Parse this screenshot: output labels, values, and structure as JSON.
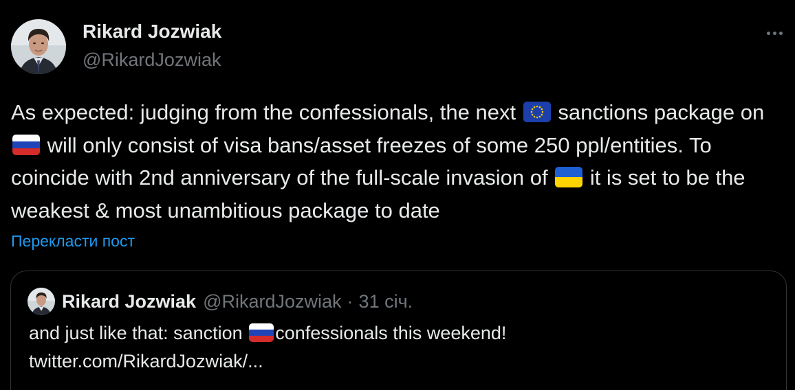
{
  "author": {
    "name": "Rikard Jozwiak",
    "handle": "@RikardJozwiak"
  },
  "tweet": {
    "part1": "As expected: judging from the confessionals, the next ",
    "flag1": "eu-flag",
    "part2": " sanctions package on ",
    "flag2": "russia-flag",
    "part3": " will only consist of visa bans/asset freezes of some 250 ppl/entities. To coincide with 2nd anniversary of the full-scale invasion of ",
    "flag3": "ukraine-flag",
    "part4": " it is set to be the weakest & most unambitious package to date"
  },
  "translate_label": "Перекласти пост",
  "quote": {
    "name": "Rikard Jozwiak",
    "handle": "@RikardJozwiak",
    "separator": "·",
    "date": "31 січ.",
    "text_part1": "and just like that: sanction ",
    "flag": "russia-flag",
    "text_part2": "confessionals this weekend!",
    "link": "twitter.com/RikardJozwiak/..."
  },
  "icons": {
    "more": "more-horizontal-icon"
  },
  "colors": {
    "background": "#000000",
    "text": "#e7e9ea",
    "secondary_text": "#71767b",
    "link": "#1d9bf0",
    "border": "#2f3336"
  }
}
